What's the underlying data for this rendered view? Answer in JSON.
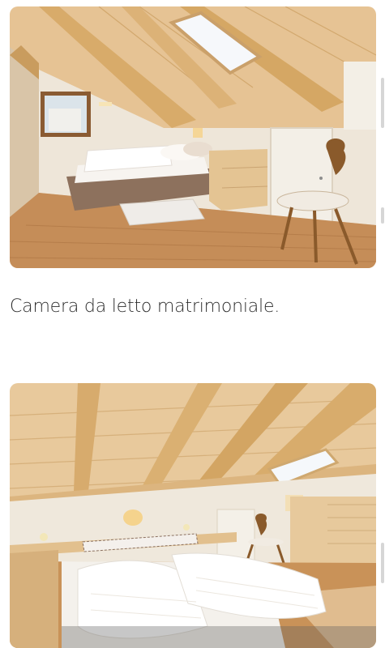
{
  "gallery": {
    "photos": [
      {
        "alt_icon": "bedroom-photo"
      },
      {
        "alt_icon": "twin-bedroom-photo"
      }
    ],
    "caption": "Camera da letto matrimoniale."
  },
  "colors": {
    "wood_light": "#e8c89a",
    "wood_beam": "#d9b47e",
    "floor": "#c48b56",
    "wall": "#eee7dc",
    "caption_text": "#2e2e2e"
  }
}
